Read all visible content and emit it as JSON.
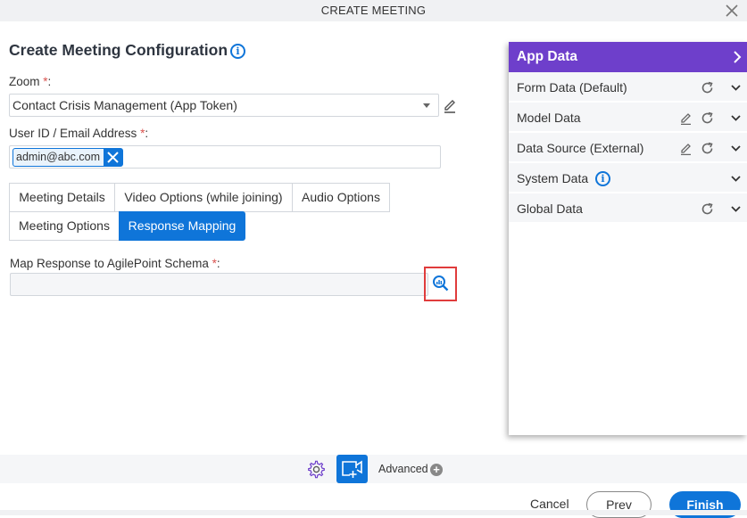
{
  "dialog": {
    "title": "CREATE MEETING"
  },
  "form": {
    "heading": "Create Meeting Configuration",
    "zoom": {
      "label": "Zoom",
      "required_mark": "*",
      "colon": ":",
      "value": "Contact Crisis Management (App Token)"
    },
    "user": {
      "label": "User ID / Email Address",
      "required_mark": "*",
      "colon": ":",
      "tags": [
        "admin@abc.com"
      ]
    },
    "tabs": [
      {
        "label": "Meeting Details",
        "active": false
      },
      {
        "label": "Video Options (while joining)",
        "active": false
      },
      {
        "label": "Audio Options",
        "active": false
      },
      {
        "label": "Meeting Options",
        "active": false
      },
      {
        "label": "Response Mapping",
        "active": true
      }
    ],
    "map_response": {
      "label": "Map Response to AgilePoint Schema",
      "required_mark": "*",
      "colon": ":",
      "value": ""
    }
  },
  "app_data": {
    "title": "App Data",
    "rows": [
      {
        "label": "Form Data (Default)",
        "edit": false,
        "refresh": true,
        "info": false
      },
      {
        "label": "Model Data",
        "edit": true,
        "refresh": true,
        "info": false
      },
      {
        "label": "Data Source (External)",
        "edit": true,
        "refresh": true,
        "info": false
      },
      {
        "label": "System Data",
        "edit": false,
        "refresh": false,
        "info": true
      },
      {
        "label": "Global Data",
        "edit": false,
        "refresh": true,
        "info": false
      }
    ]
  },
  "toolbar": {
    "advanced_label": "Advanced"
  },
  "footer": {
    "cancel_label": "Cancel",
    "prev_label": "Prev",
    "finish_label": "Finish"
  },
  "colors": {
    "accent": "#0f75d9",
    "panel_header": "#6e3fcb",
    "required": "#d9534f",
    "highlight_box": "#e03c3c"
  }
}
